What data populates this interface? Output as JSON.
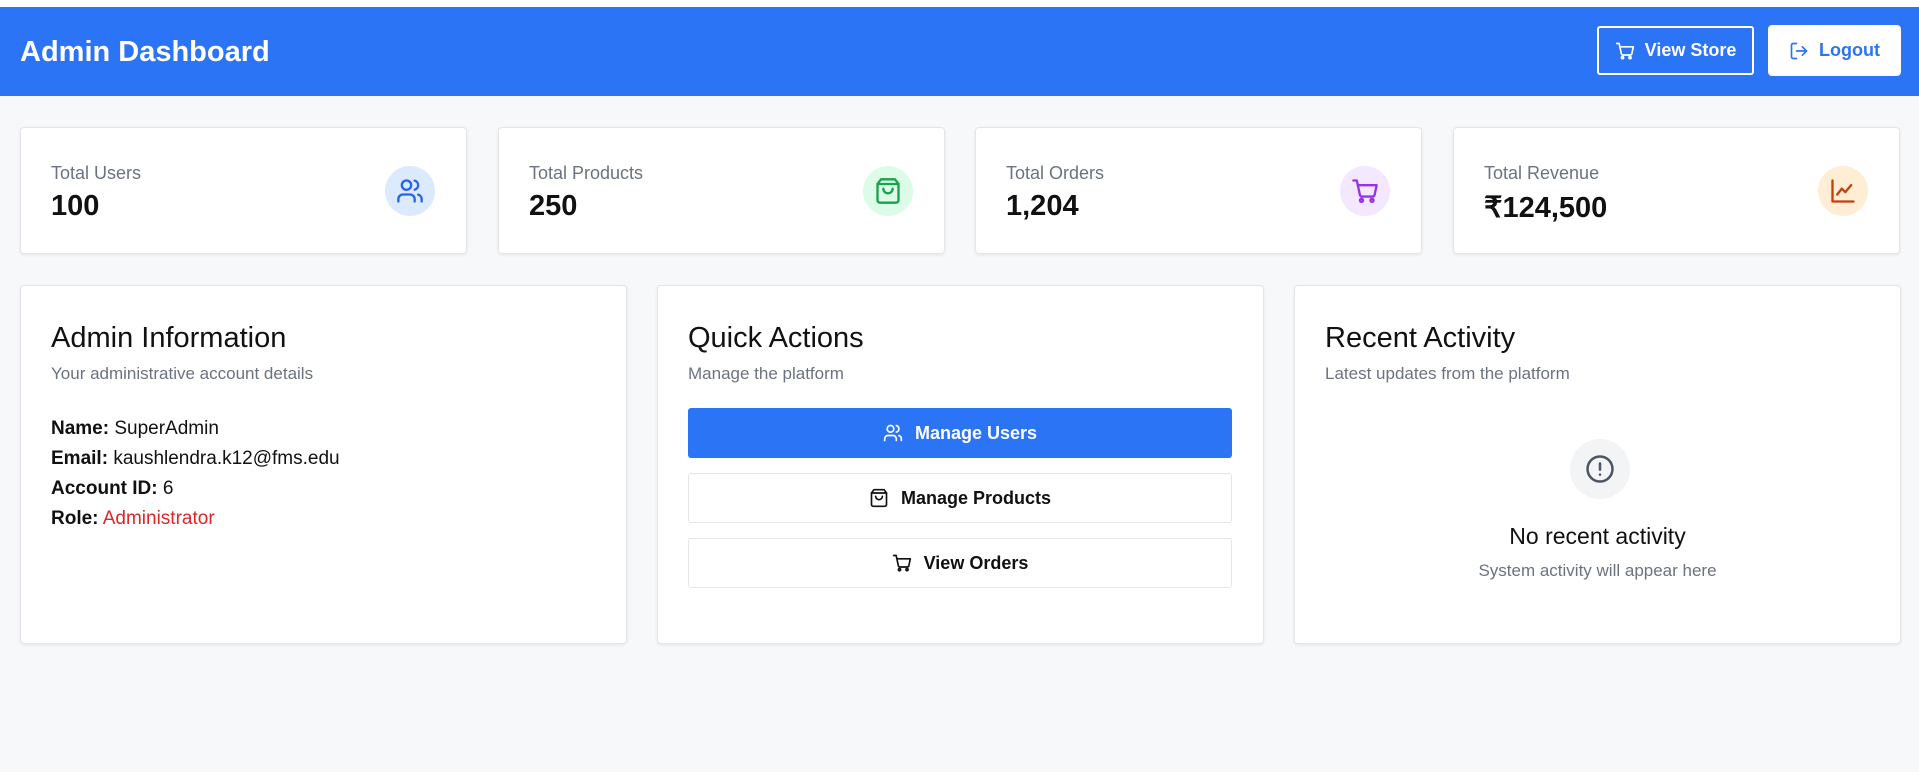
{
  "header": {
    "title": "Admin Dashboard",
    "view_store_label": "View Store",
    "logout_label": "Logout",
    "accent_color": "#2a74f5"
  },
  "stats": [
    {
      "label": "Total Users",
      "value": "100",
      "icon": "users-icon",
      "icon_color": "#2563eb",
      "icon_bg": "#dbeafe"
    },
    {
      "label": "Total Products",
      "value": "250",
      "icon": "shopping-bag-icon",
      "icon_color": "#16a34a",
      "icon_bg": "#dcfce7"
    },
    {
      "label": "Total Orders",
      "value": "1,204",
      "icon": "cart-icon",
      "icon_color": "#9333ea",
      "icon_bg": "#f3e8ff"
    },
    {
      "label": "Total Revenue",
      "value": "₹124,500",
      "icon": "trend-chart-icon",
      "icon_color": "#c2410c",
      "icon_bg": "#ffedd5"
    }
  ],
  "admin_info": {
    "title": "Admin Information",
    "subtitle": "Your administrative account details",
    "name_label": "Name:",
    "name": "SuperAdmin",
    "email_label": "Email:",
    "email": "kaushlendra.k12@fms.edu",
    "account_id_label": "Account ID:",
    "account_id": "6",
    "role_label": "Role:",
    "role": "Administrator",
    "role_color": "#dc2626"
  },
  "quick_actions": {
    "title": "Quick Actions",
    "subtitle": "Manage the platform",
    "manage_users_label": "Manage Users",
    "manage_products_label": "Manage Products",
    "view_orders_label": "View Orders"
  },
  "recent_activity": {
    "title": "Recent Activity",
    "subtitle": "Latest updates from the platform",
    "empty_title": "No recent activity",
    "empty_subtitle": "System activity will appear here"
  }
}
